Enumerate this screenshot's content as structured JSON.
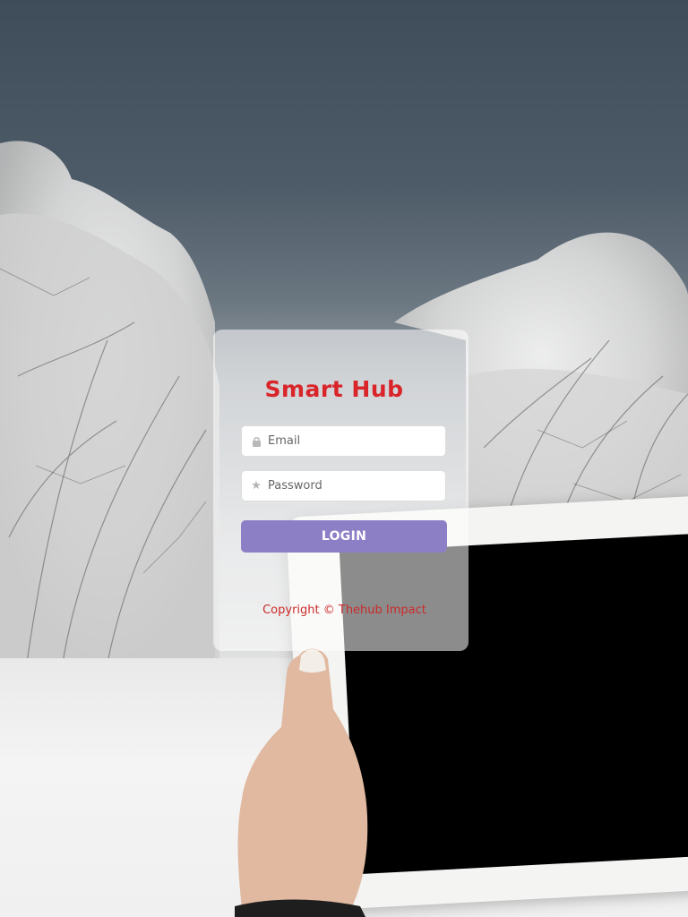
{
  "brand": {
    "title": "Smart Hub",
    "color": "#d9252a"
  },
  "form": {
    "email": {
      "icon": "lock-icon",
      "placeholder": "Email",
      "value": ""
    },
    "password": {
      "icon": "star-icon",
      "placeholder": "Password",
      "value": ""
    },
    "login_label": "LOGIN",
    "login_color": "#8d7fc6"
  },
  "footer": {
    "copyright": "Copyright © Thehub Impact",
    "color": "#cc2a2a"
  }
}
